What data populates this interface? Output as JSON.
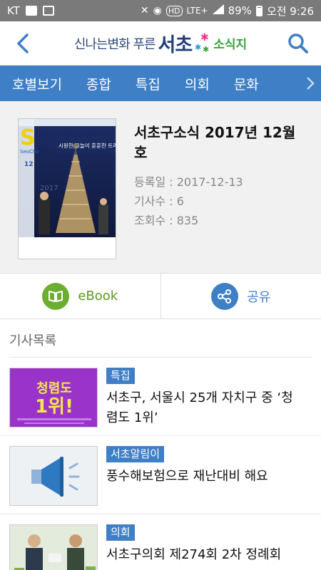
{
  "status_bar": {
    "carrier": "KT",
    "battery": "89%",
    "time": "오전 9:26",
    "network": "LTE+"
  },
  "header": {
    "slogan": "신나는변화 푸른",
    "brand": "서초",
    "sub": "소식지",
    "back_icon": "chevron-left-icon",
    "search_icon": "search-icon"
  },
  "tabs": [
    {
      "label": "호별보기"
    },
    {
      "label": "종합"
    },
    {
      "label": "특집"
    },
    {
      "label": "의회"
    },
    {
      "label": "문화"
    }
  ],
  "issue": {
    "title": "서초구소식 2017년 12월호",
    "registered": "등록일 : 2017-12-13",
    "article_count": "기사수 : 6",
    "views": "조회수 : 835",
    "cover": {
      "letter": "S",
      "name": "SeoCho",
      "issue_no": "12",
      "headline": "시원한 그늘이 훈훈한 트리로"
    }
  },
  "actions": {
    "ebook": "eBook",
    "share": "공유"
  },
  "articles_title": "기사목록",
  "articles": [
    {
      "category": "특집",
      "title": "서초구, 서울시 25개 자치구 중 ‘청렴도 1위’",
      "thumb_line1": "청렴도",
      "thumb_line2": "1위!"
    },
    {
      "category": "서초알림이",
      "title": "풍수해보험으로 재난대비 해요"
    },
    {
      "category": "의회",
      "title": "서초구의회 제274회 2차 정례회"
    }
  ],
  "colors": {
    "primary_blue": "#3f7fc6",
    "ebook_green": "#6cae30",
    "navy": "#233e7a",
    "status_gray": "#7a7a7a"
  }
}
